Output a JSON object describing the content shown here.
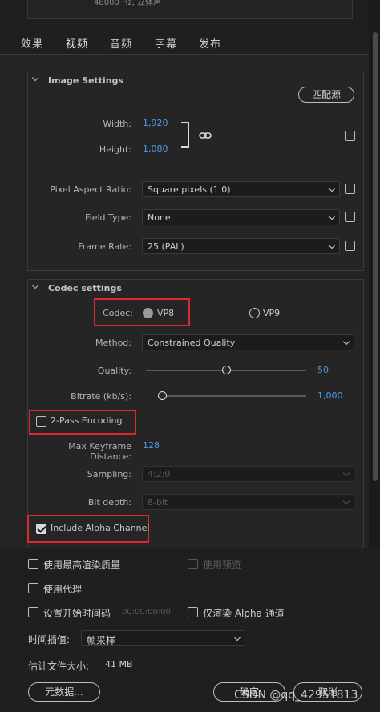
{
  "top_panel": {
    "text": "48000 Hz, 立体声"
  },
  "tabs": [
    {
      "label": "效果"
    },
    {
      "label": "视频"
    },
    {
      "label": "音频"
    },
    {
      "label": "字幕"
    },
    {
      "label": "发布"
    }
  ],
  "active_tab": "视频",
  "image_settings": {
    "title": "Image Settings",
    "match_source": "匹配源",
    "width_label": "Width:",
    "width_value": "1,920",
    "height_label": "Height:",
    "height_value": "1,080",
    "par_label": "Pixel Aspect Ratio:",
    "par_value": "Square pixels (1.0)",
    "field_type_label": "Field Type:",
    "field_type_value": "None",
    "frame_rate_label": "Frame Rate:",
    "frame_rate_value": "25 (PAL)"
  },
  "codec_settings": {
    "title": "Codec settings",
    "codec_label": "Codec:",
    "codec_option_1": "VP8",
    "codec_option_2": "VP9",
    "codec_selected": "VP8",
    "method_label": "Method:",
    "method_value": "Constrained Quality",
    "quality_label": "Quality:",
    "quality_value": "50",
    "quality_fraction": 0.5,
    "bitrate_label": "Bitrate (kb/s):",
    "bitrate_value": "1,000",
    "bitrate_fraction": 0.0,
    "two_pass_label": "2-Pass Encoding",
    "two_pass_checked": false,
    "max_keyframe_label": "Max Keyframe Distance:",
    "max_keyframe_value": "128",
    "sampling_label": "Sampling:",
    "sampling_value": "4:2:0",
    "bit_depth_label": "Bit depth:",
    "bit_depth_value": "8-bit",
    "include_alpha_label": "Include Alpha Channel",
    "include_alpha_checked": true
  },
  "footer": {
    "max_render_label": "使用最高渲染质量",
    "use_preview_label": "使用预览",
    "use_proxy_label": "使用代理",
    "set_start_tc_label": "设置开始时间码",
    "start_tc_value": "00:00:00:00",
    "render_alpha_only_label": "仅渲染 Alpha 通道",
    "time_interp_label": "时间插值:",
    "time_interp_value": "帧采样",
    "est_size_label": "估计文件大小:",
    "est_size_value": "41 MB",
    "metadata_button": "元数据...",
    "ok_button": "确定",
    "cancel_button": "取消"
  },
  "watermark": "CSDN @qq_42951813",
  "colors": {
    "accent_blue": "#4d9be6",
    "highlight_red": "#e0272d"
  }
}
